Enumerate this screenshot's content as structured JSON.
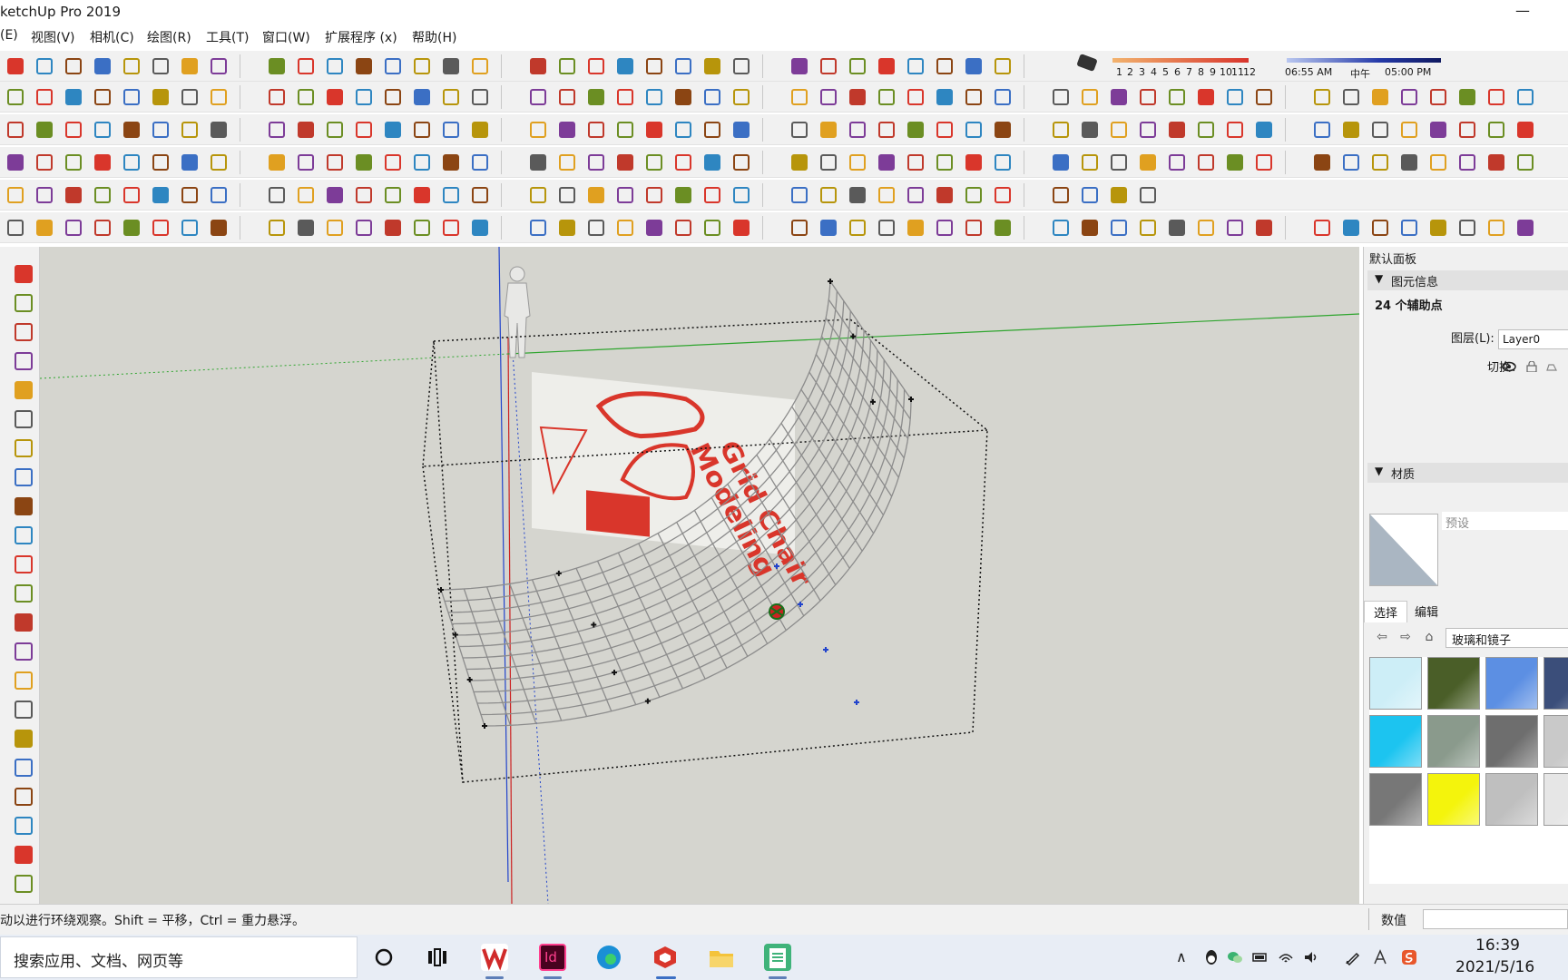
{
  "app": {
    "title": "ketchUp Pro 2019",
    "minimize_glyph": "—"
  },
  "menu": [
    {
      "label": "(E)"
    },
    {
      "label": "视图(V)"
    },
    {
      "label": "相机(C)"
    },
    {
      "label": "绘图(R)"
    },
    {
      "label": "工具(T)"
    },
    {
      "label": "窗口(W)"
    },
    {
      "label": "扩展程序 (x)"
    },
    {
      "label": "帮助(H)"
    }
  ],
  "shadow_settings": {
    "months": [
      "1",
      "2",
      "3",
      "4",
      "5",
      "6",
      "7",
      "8",
      "9",
      "10",
      "11",
      "12"
    ],
    "time_start": "06:55 AM",
    "time_mid": "中午",
    "time_end": "05:00 PM"
  },
  "viewport": {
    "logo_line1": "Grid Chair",
    "logo_line2": "Modeling",
    "colors": {
      "background": "#d5d5cf",
      "red_axis": "#cc2222",
      "green_axis": "#2ea52e",
      "blue_axis": "#2244cc",
      "grid": "#8c8c8c",
      "logo_accent": "#d9362b"
    }
  },
  "tray": {
    "header": "默认面板",
    "entity_info": {
      "title": "图元信息",
      "selection_summary": "24 个辅助点",
      "layer_label": "图层(L):",
      "layer_value": "Layer0",
      "toggle_label": "切换："
    },
    "materials": {
      "title": "材质",
      "name_placeholder": "预设",
      "tabs": [
        "选择",
        "编辑"
      ],
      "library": "玻璃和镜子",
      "swatch_colors": [
        "#cdeef7",
        "#4a5e28",
        "#5c8fe3",
        "#3b4e7a",
        "#1cc4f0",
        "#8a9a8c",
        "#6e6e6e",
        "#c9c9c9",
        "#777777",
        "#f4f40c",
        "#bfbfbf",
        "#e6e6e6"
      ]
    }
  },
  "status": {
    "hint": "动以进行环绕观察。Shift = 平移，Ctrl = 重力悬浮。",
    "measurements_label": "数值"
  },
  "taskbar": {
    "search_placeholder": "搜索应用、文档、网页等",
    "time": "16:39",
    "date": "2021/5/16"
  }
}
